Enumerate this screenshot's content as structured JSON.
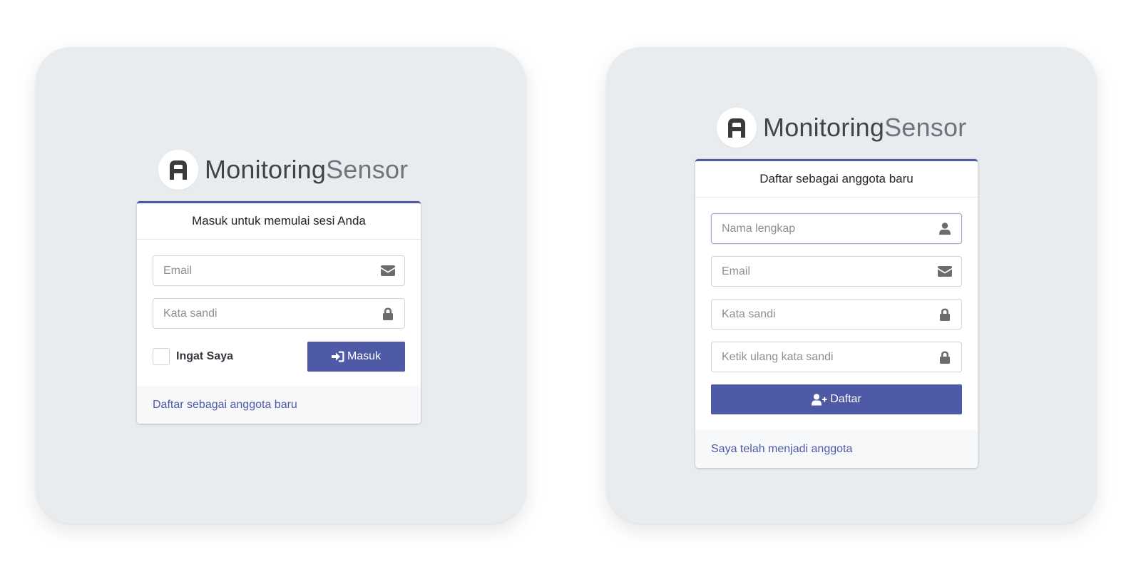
{
  "brand": {
    "name_bold": "Monitoring",
    "name_light": "Sensor"
  },
  "login": {
    "header": "Masuk untuk memulai sesi Anda",
    "email_placeholder": "Email",
    "password_placeholder": "Kata sandi",
    "remember_label": "Ingat Saya",
    "submit_label": "Masuk",
    "register_link": "Daftar sebagai anggota baru"
  },
  "register": {
    "header": "Daftar sebagai anggota baru",
    "name_placeholder": "Nama lengkap",
    "email_placeholder": "Email",
    "password_placeholder": "Kata sandi",
    "retype_placeholder": "Ketik ulang kata sandi",
    "submit_label": "Daftar",
    "login_link": "Saya telah menjadi anggota"
  },
  "colors": {
    "accent": "#4f5aa7",
    "panel_bg": "#e9ecef",
    "icon": "#6c6c6c"
  },
  "icons": [
    "logo-icon",
    "envelope-icon",
    "lock-icon",
    "user-icon",
    "sign-in-icon",
    "user-plus-icon"
  ]
}
